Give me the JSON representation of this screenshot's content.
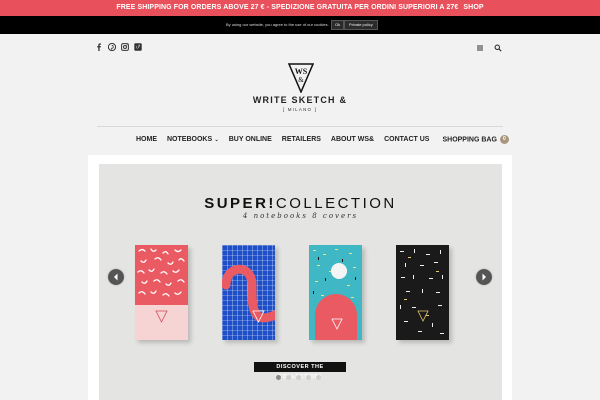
{
  "promo": {
    "text": "FREE SHIPPING FOR ORDERS ABOVE 27 € - SPEDIZIONE GRATUITA PER ORDINI SUPERIORI A 27€",
    "link": "SHOP"
  },
  "cookie": {
    "message": "By using our website, you agree to the use of our cookies.",
    "ok_label": "Ok",
    "policy_label": "Private policy"
  },
  "social_icons": [
    "facebook-icon",
    "pinterest-icon",
    "instagram-icon",
    "vimeo-icon"
  ],
  "utility_icons": [
    "menu-icon",
    "search-icon"
  ],
  "brand": {
    "logo_text": "WS&",
    "name": "WRITE SKETCH &",
    "subtitle": "[ MILANO ]"
  },
  "nav": {
    "items": [
      {
        "label": "HOME"
      },
      {
        "label": "NOTEBOOKS"
      },
      {
        "label": "BUY ONLINE"
      },
      {
        "label": "RETAILERS"
      },
      {
        "label": "ABOUT WS&"
      },
      {
        "label": "CONTACT US"
      }
    ],
    "bag_label": "SHOPPING BAG",
    "bag_count": "0"
  },
  "hero": {
    "title_bold": "SUPER!",
    "title_rest": "COLLECTION",
    "subtitle": "4 notebooks 8 covers",
    "cta": "DISCOVER THE COLLECTION!",
    "slides": 5,
    "active_slide": 1
  },
  "colors": {
    "promo": "#e8505b",
    "accent": "#a9967e",
    "book_pink": "#e8505b",
    "book_blue": "#1f4fc7",
    "book_teal": "#3fb7c4"
  }
}
